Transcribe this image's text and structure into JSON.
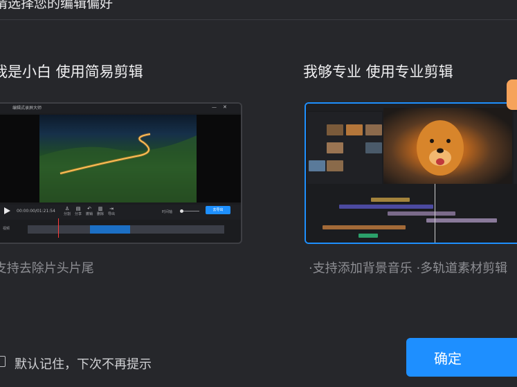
{
  "header": {
    "title": "请选择您的编辑偏好"
  },
  "options": {
    "simple": {
      "title": "我是小白 使用简易剪辑",
      "description": "·支持去除片头片尾",
      "preview": {
        "window_title": "编辑式录屏大师",
        "timecode": "00:00:00/01:21:54",
        "tools": [
          "分割",
          "分享",
          "撤销",
          "删除",
          "导出"
        ],
        "track_label": "视频",
        "export_label": "去导出",
        "toggle_label": "时间轴"
      }
    },
    "pro": {
      "title": "我够专业 使用专业剪辑",
      "description": "·支持添加背景音乐 ·多轨道素材剪辑"
    }
  },
  "remember": {
    "label": "默认记住，下次不再提示",
    "checked": false
  },
  "confirm": {
    "label": "确定"
  },
  "colors": {
    "accent": "#1e8fff",
    "background": "#26272b"
  }
}
